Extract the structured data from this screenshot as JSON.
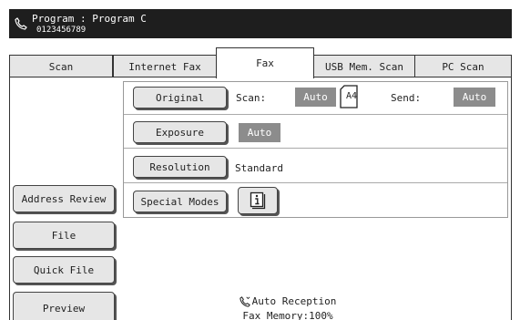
{
  "header": {
    "program": "Program : Program C",
    "number": "0123456789"
  },
  "tabs": [
    {
      "label": "Scan",
      "active": false
    },
    {
      "label": "Internet Fax",
      "active": false
    },
    {
      "label": "Fax",
      "active": true
    },
    {
      "label": "USB Mem. Scan",
      "active": false
    },
    {
      "label": "PC Scan",
      "active": false
    }
  ],
  "settings": {
    "original_label": "Original",
    "scan_label": "Scan:",
    "scan_value": "Auto",
    "paper_size": "A4",
    "send_label": "Send:",
    "send_value": "Auto",
    "exposure_label": "Exposure",
    "exposure_value": "Auto",
    "resolution_label": "Resolution",
    "resolution_value": "Standard",
    "special_modes_label": "Special Modes"
  },
  "sidebar": {
    "address_review": "Address Review",
    "file": "File",
    "quick_file": "Quick File",
    "preview": "Preview"
  },
  "status": {
    "reception": "Auto Reception",
    "memory": "Fax Memory:100%"
  }
}
